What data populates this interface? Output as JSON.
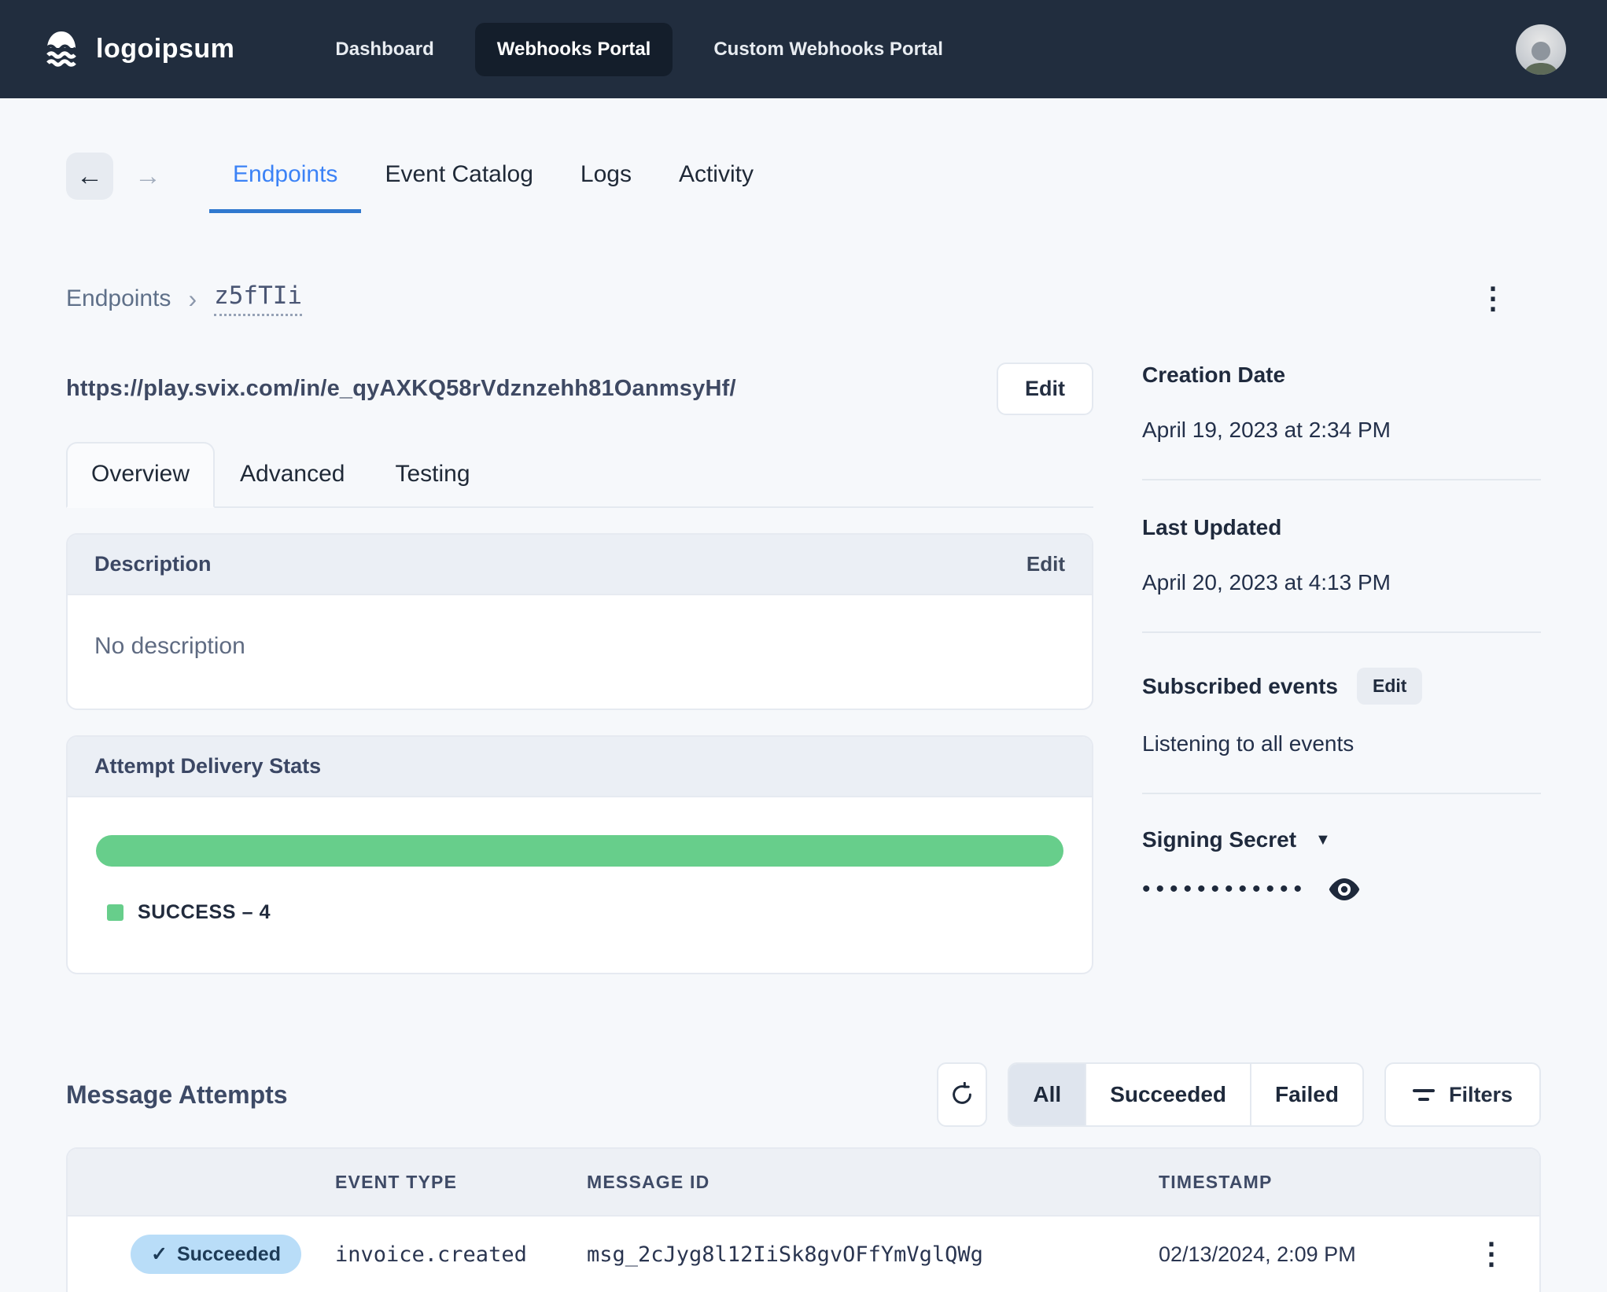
{
  "nav": {
    "brand": "logoipsum",
    "items": [
      {
        "label": "Dashboard",
        "active": false
      },
      {
        "label": "Webhooks Portal",
        "active": true
      },
      {
        "label": "Custom Webhooks Portal",
        "active": false
      }
    ]
  },
  "portal_tabs": {
    "active": "Endpoints",
    "items": [
      {
        "label": "Endpoints"
      },
      {
        "label": "Event Catalog"
      },
      {
        "label": "Logs"
      },
      {
        "label": "Activity"
      }
    ]
  },
  "breadcrumb": {
    "root": "Endpoints",
    "separator": "›",
    "current": "z5fTIi"
  },
  "endpoint": {
    "url": "https://play.svix.com/in/e_qyAXKQ58rVdznzehh81OanmsyHf/",
    "edit_label": "Edit"
  },
  "detail_tabs": {
    "active": "Overview",
    "items": [
      {
        "label": "Overview"
      },
      {
        "label": "Advanced"
      },
      {
        "label": "Testing"
      }
    ]
  },
  "description": {
    "title": "Description",
    "edit_label": "Edit",
    "empty_text": "No description"
  },
  "delivery_stats": {
    "title": "Attempt Delivery Stats",
    "legend_label": "SUCCESS – 4",
    "success_count": 4,
    "bar_color": "#67ce8b",
    "bar_fraction": 1
  },
  "sidebar": {
    "creation_date": {
      "label": "Creation Date",
      "value": "April 19, 2023 at 2:34 PM"
    },
    "last_updated": {
      "label": "Last Updated",
      "value": "April 20, 2023 at 4:13 PM"
    },
    "subscribed_events": {
      "label": "Subscribed events",
      "edit_label": "Edit",
      "value": "Listening to all events"
    },
    "signing_secret": {
      "label": "Signing Secret",
      "masked_value": "••••••••••••"
    }
  },
  "attempts": {
    "title": "Message Attempts",
    "segments": [
      {
        "label": "All",
        "active": true
      },
      {
        "label": "Succeeded",
        "active": false
      },
      {
        "label": "Failed",
        "active": false
      }
    ],
    "filters_label": "Filters",
    "table": {
      "headers": [
        "Event Type",
        "Message ID",
        "Timestamp"
      ],
      "rows": [
        {
          "status": "Succeeded",
          "event_type": "invoice.created",
          "message_id": "msg_2cJyg8l12IiSk8gvOFfYmVglQWg",
          "timestamp": "02/13/2024, 2:09 PM"
        }
      ]
    }
  },
  "colors": {
    "accent_blue": "#3b82f6",
    "success_green": "#67ce8b",
    "badge_blue": "#b9ddf8",
    "nav_bg": "#212d3e"
  }
}
